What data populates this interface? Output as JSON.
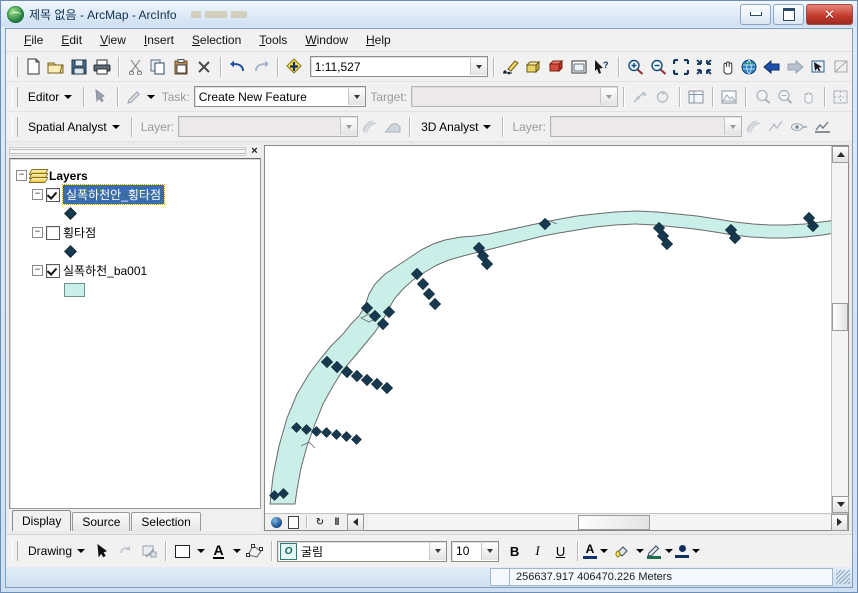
{
  "window": {
    "title": "제목 없음 - ArcMap - ArcInfo",
    "app_icon": "globe-icon",
    "minimize_label": "Minimize",
    "maximize_label": "Maximize",
    "close_label": "Close"
  },
  "menu": {
    "items": [
      {
        "label": "File",
        "accel": "F"
      },
      {
        "label": "Edit",
        "accel": "E"
      },
      {
        "label": "View",
        "accel": "V"
      },
      {
        "label": "Insert",
        "accel": "I"
      },
      {
        "label": "Selection",
        "accel": "S"
      },
      {
        "label": "Tools",
        "accel": "T"
      },
      {
        "label": "Window",
        "accel": "W"
      },
      {
        "label": "Help",
        "accel": "H"
      }
    ]
  },
  "standard_toolbar": {
    "buttons": [
      {
        "name": "new-document-icon",
        "glyph": "὜B"
      },
      {
        "name": "open-folder-icon",
        "glyph": "folder"
      },
      {
        "name": "save-icon",
        "glyph": "floppy"
      },
      {
        "name": "print-icon",
        "glyph": "printer"
      },
      {
        "name": "cut-icon",
        "glyph": "scissors"
      },
      {
        "name": "copy-icon",
        "glyph": "copy"
      },
      {
        "name": "paste-icon",
        "glyph": "clipboard"
      },
      {
        "name": "delete-icon",
        "glyph": "×"
      },
      {
        "name": "undo-icon",
        "glyph": "↶"
      },
      {
        "name": "redo-icon",
        "glyph": "↷"
      },
      {
        "name": "add-data-icon",
        "glyph": "plus-diamond"
      }
    ],
    "scale": {
      "label": "Map Scale",
      "value": "1:11,527"
    },
    "right_buttons": [
      {
        "name": "editor-toolbar-icon"
      },
      {
        "name": "arctoolbox-icon"
      },
      {
        "name": "model-builder-icon"
      },
      {
        "name": "show-command-line-icon"
      },
      {
        "name": "what-is-this-icon"
      },
      {
        "name": "zoom-in-icon"
      },
      {
        "name": "zoom-out-icon"
      },
      {
        "name": "fixed-zoom-in-icon"
      },
      {
        "name": "fixed-zoom-out-icon"
      },
      {
        "name": "pan-icon"
      },
      {
        "name": "full-extent-icon"
      },
      {
        "name": "back-extent-icon"
      },
      {
        "name": "forward-extent-icon"
      },
      {
        "name": "select-features-icon"
      },
      {
        "name": "clear-selection-icon"
      }
    ]
  },
  "editor_toolbar": {
    "menu_label": "Editor",
    "menu_accel": "r",
    "edit-tool-icon": "arrow-icon",
    "sketch-tool-icon": "pencil-icon",
    "task_label": "Task:",
    "task_value": "Create New Feature",
    "target_label": "Target:",
    "target_value": "",
    "right_buttons": [
      {
        "name": "split-tool-icon"
      },
      {
        "name": "rotate-tool-icon"
      },
      {
        "name": "attributes-icon"
      },
      {
        "name": "sketch-properties-icon"
      },
      {
        "name": "zoom-select-icon"
      },
      {
        "name": "zoom-select2-icon"
      },
      {
        "name": "pan-edit-icon"
      },
      {
        "name": "grid-icon"
      }
    ]
  },
  "spatial_analyst_toolbar": {
    "menu_label": "Spatial Analyst",
    "menu_accel": "A",
    "layer_label": "Layer:",
    "layer_value": "",
    "buttons": [
      {
        "name": "histogram-icon"
      },
      {
        "name": "contour-icon"
      }
    ]
  },
  "analyst3d_toolbar": {
    "menu_label": "3D Analyst",
    "menu_accel": "3",
    "layer_label": "Layer:",
    "layer_value": "",
    "buttons": [
      {
        "name": "surface-icon"
      },
      {
        "name": "interpolate-icon"
      },
      {
        "name": "line-of-sight-icon"
      },
      {
        "name": "create-profile-icon"
      }
    ]
  },
  "toc": {
    "close_label": "×",
    "root": {
      "label": "Layers",
      "expanded": true,
      "icon": "layers-icon"
    },
    "layers": [
      {
        "label": "실폭하천안_횡타점",
        "checked": true,
        "selected": true,
        "expanded": true,
        "symbol": "diamond-point"
      },
      {
        "label": "횡타점",
        "checked": false,
        "selected": false,
        "expanded": true,
        "symbol": "diamond-point"
      },
      {
        "label": "실폭하천_ba001",
        "checked": true,
        "selected": false,
        "expanded": true,
        "symbol": "polygon-fill"
      }
    ],
    "tabs": [
      {
        "label": "Display",
        "active": true
      },
      {
        "label": "Source",
        "active": false
      },
      {
        "label": "Selection",
        "active": false
      }
    ]
  },
  "map": {
    "polygon_fill": "#c9efe8",
    "polygon_outline": "#6b6b6b",
    "point_color": "#17394f",
    "background": "#ffffff",
    "data_view_buttons": [
      {
        "name": "data-view-icon"
      },
      {
        "name": "layout-view-icon"
      },
      {
        "name": "refresh-icon"
      },
      {
        "name": "pause-drawing-icon"
      },
      {
        "name": "toggle-draw-icon"
      }
    ]
  },
  "drawing_toolbar": {
    "menu_label": "Drawing",
    "menu_accel": "D",
    "select-elements-icon": "arrow-icon",
    "rotate-element-icon": "rotate-icon",
    "graphic-convert-icon": "convert-icon",
    "new-rectangle-icon": "rectangle-icon",
    "new-text-icon": "A",
    "edit-vertices-icon": "vertices-icon",
    "font_name": "굴림",
    "font_size": "10",
    "bold_label": "B",
    "italic_label": "I",
    "underline_label": "U",
    "font_color_label": "A",
    "fill_color_icon": "paint-bucket-icon",
    "line_color_icon": "pen-icon",
    "marker_color_icon": "marker-icon"
  },
  "status_bar": {
    "coordinates": "256637.917  406470.226  Meters"
  }
}
